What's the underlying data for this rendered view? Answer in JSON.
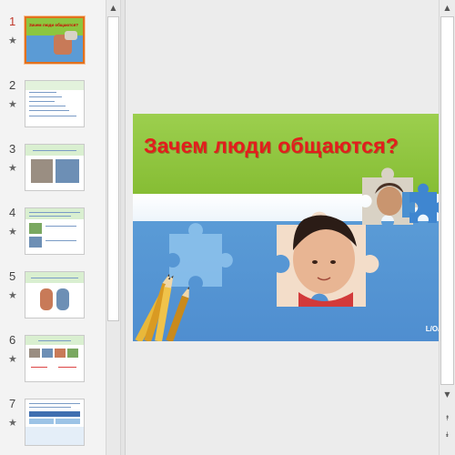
{
  "thumbnails": [
    {
      "number": "1",
      "star": "★",
      "title": "Зачем люди общаются?",
      "selected": true
    },
    {
      "number": "2",
      "star": "★"
    },
    {
      "number": "3",
      "star": "★"
    },
    {
      "number": "4",
      "star": "★"
    },
    {
      "number": "5",
      "star": "★"
    },
    {
      "number": "6",
      "star": "★"
    },
    {
      "number": "7",
      "star": "★"
    }
  ],
  "slide": {
    "title": "Зачем люди общаются?",
    "logo": "L/O/G/O"
  },
  "icons": {
    "scroll_up": "▲",
    "scroll_down": "▼",
    "prev_slide": "⯭",
    "next_slide": "⯯"
  },
  "colors": {
    "accent_selected": "#e2711d",
    "slide_number_selected": "#c0392b",
    "slide_green": "#8cc63f",
    "slide_blue": "#5a9bd6",
    "title_red": "#e31d1d"
  }
}
